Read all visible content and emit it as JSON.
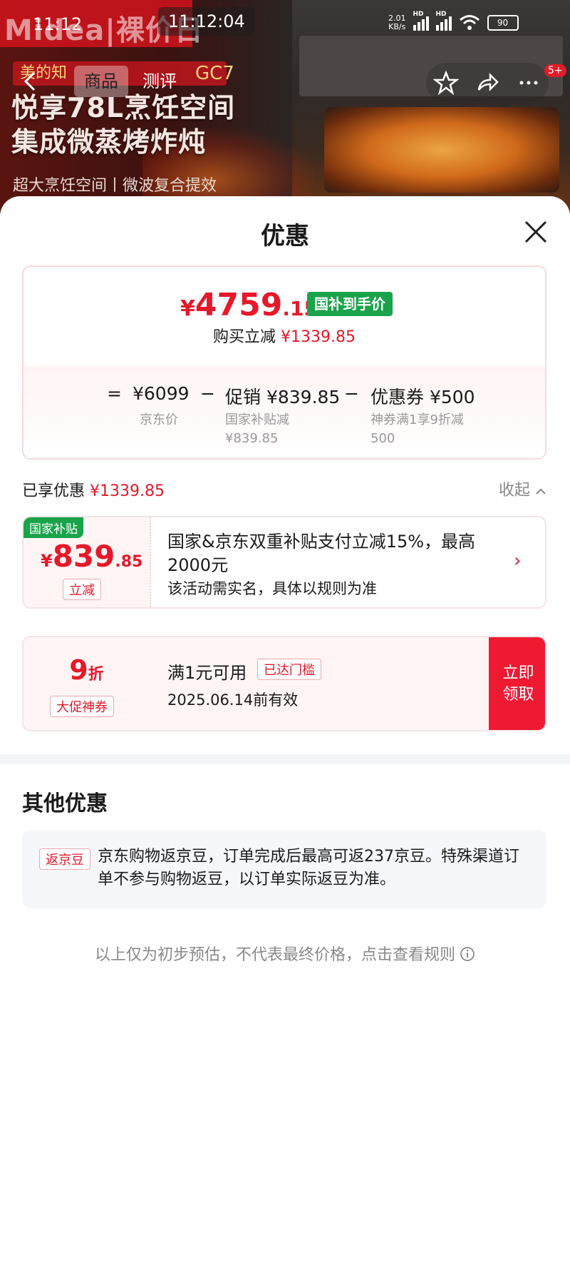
{
  "status_bar": {
    "time": "11:12",
    "clock_overlay": "11:12:04",
    "net_speed": "2.01\nKB/s",
    "battery": "90"
  },
  "banner": {
    "brand": "Midea|裸价日",
    "promo": "美的知",
    "model": "GC7",
    "headline_1": "悦享78L烹饪空间",
    "headline_2": "集成微蒸烤炸炖",
    "subline": "超大烹饪空间丨微波复合提效"
  },
  "nav": {
    "tabs": [
      "商品",
      "测评"
    ],
    "badge": "5+"
  },
  "sheet": {
    "title": "优惠",
    "price": {
      "yen": "¥",
      "int": "4759",
      "dec": ".15",
      "tag": "国补到手价"
    },
    "reduce": {
      "label": "购买立减",
      "value": "¥1339.85"
    },
    "formula": {
      "eq": "=",
      "base": {
        "value": "¥6099",
        "label": "京东价"
      },
      "promo": {
        "op": "−",
        "value": "促销 ¥839.85",
        "label_1": "国家补贴减",
        "label_2": "¥839.85"
      },
      "coupon": {
        "op": "−",
        "value": "优惠券 ¥500",
        "label_1": "神券满1享9折减",
        "label_2": "500"
      }
    },
    "enjoyed": {
      "label": "已享优惠",
      "value": "¥1339.85",
      "collapse": "收起"
    },
    "subsidy_card": {
      "corner": "国家补贴",
      "yen": "¥",
      "int": "839",
      "dec": ".85",
      "tag": "立减",
      "title": "国家&京东双重补贴支付立减15%，最高2000元",
      "desc": "该活动需实名，具体以规则为准",
      "chevron": "›"
    },
    "coupon_card": {
      "num": "9",
      "unit": "折",
      "tag": "大促神券",
      "title": "满1元可用",
      "status": "已达门槛",
      "valid": "2025.06.14前有效",
      "button_1": "立即",
      "button_2": "领取"
    },
    "other": {
      "title": "其他优惠",
      "bean_tag": "返京豆",
      "bean_text": "京东购物返京豆，订单完成后最高可返237京豆。特殊渠道订单不参与购物返豆，以订单实际返豆为准。"
    },
    "footnote": "以上仅为初步预估，不代表最终价格，点击查看规则"
  },
  "colors": {
    "accent_red": "#e5192a",
    "subsidy_green": "#1aa34a",
    "claim_red": "#ef1a32"
  }
}
